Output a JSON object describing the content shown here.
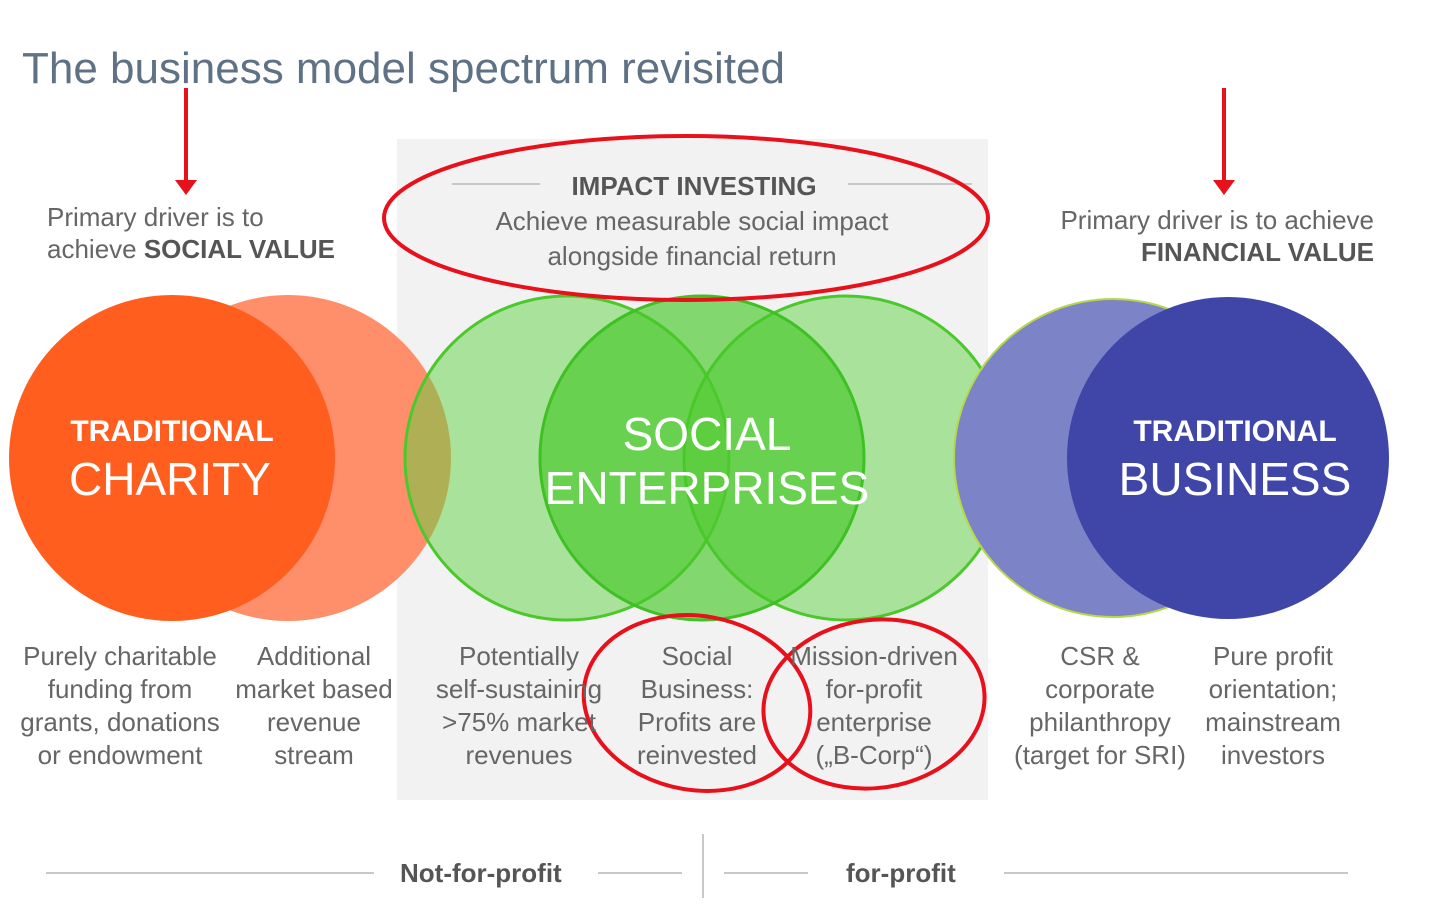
{
  "title": "The business model spectrum revisited",
  "drivers": {
    "left": {
      "line1": "Primary driver is to",
      "line2_prefix": "achieve ",
      "line2_bold": "SOCIAL VALUE"
    },
    "right": {
      "line1": "Primary driver is to achieve",
      "line2_bold": "FINANCIAL VALUE"
    }
  },
  "impact_investing": {
    "label": "IMPACT INVESTING",
    "line1": "Achieve measurable social impact",
    "line2": "alongside financial return"
  },
  "circles": {
    "charity": {
      "small": "TRADITIONAL",
      "big": "CHARITY"
    },
    "social": {
      "line1": "SOCIAL",
      "line2": "ENTERPRISES"
    },
    "business": {
      "small": "TRADITIONAL",
      "big": "BUSINESS"
    }
  },
  "columns": [
    "Purely charitable\nfunding from\ngrants, donations\nor endowment",
    "Additional\nmarket based\nrevenue\nstream",
    "Potentially\nself-sustaining\n>75% market\nrevenues",
    "Social\nBusiness:\nProfits are\nreinvested",
    "Mission-driven\nfor-profit\nenterprise\n(„B-Corp“)",
    "CSR &\ncorporate\nphilanthropy\n(target for SRI)",
    "Pure profit\norientation;\nmainstream\ninvestors"
  ],
  "footer": {
    "left": "Not-for-profit",
    "right": "for-profit"
  },
  "colors": {
    "charity_main": "#ff5e1f",
    "charity_light": "#ff8c66",
    "social_green": "#4fcf2a",
    "business_main": "#3f46a8",
    "business_light": "#7f86c8",
    "annotation_red": "#e8101a",
    "band_gray": "#f1f1f1"
  }
}
